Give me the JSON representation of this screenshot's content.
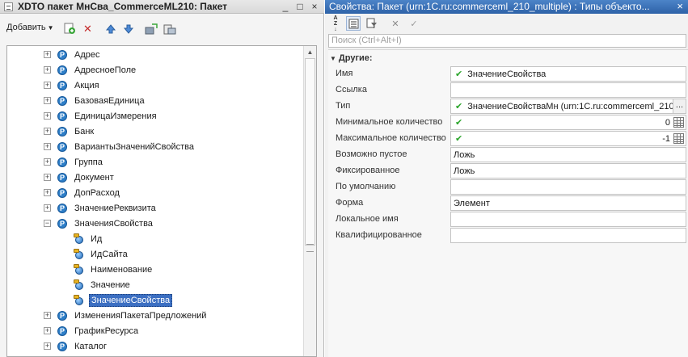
{
  "left_window": {
    "title": "XDTO пакет МнСва_CommerceML210: Пакет",
    "buttons": {
      "minimize": "_",
      "maximize": "□",
      "close": "×"
    },
    "toolbar": {
      "add_label": "Добавить",
      "icons": [
        "add-element-icon",
        "delete-icon",
        "move-up-icon",
        "move-down-icon",
        "import-icon",
        "export-icon"
      ]
    },
    "tree": {
      "items": [
        {
          "label": "Адрес",
          "kind": "package",
          "expanded": false
        },
        {
          "label": "АдресноеПоле",
          "kind": "package",
          "expanded": false
        },
        {
          "label": "Акция",
          "kind": "package",
          "expanded": false
        },
        {
          "label": "БазоваяЕдиница",
          "kind": "package",
          "expanded": false
        },
        {
          "label": "ЕдиницаИзмерения",
          "kind": "package",
          "expanded": false
        },
        {
          "label": "Банк",
          "kind": "package",
          "expanded": false
        },
        {
          "label": "ВариантыЗначенийСвойства",
          "kind": "package",
          "expanded": false
        },
        {
          "label": "Группа",
          "kind": "package",
          "expanded": false
        },
        {
          "label": "Документ",
          "kind": "package",
          "expanded": false
        },
        {
          "label": "ДопРасход",
          "kind": "package",
          "expanded": false
        },
        {
          "label": "ЗначениеРеквизита",
          "kind": "package",
          "expanded": false
        },
        {
          "label": "ЗначенияСвойства",
          "kind": "package",
          "expanded": true
        },
        {
          "label": "Ид",
          "kind": "property"
        },
        {
          "label": "ИдСайта",
          "kind": "property"
        },
        {
          "label": "Наименование",
          "kind": "property"
        },
        {
          "label": "Значение",
          "kind": "property"
        },
        {
          "label": "ЗначениеСвойства",
          "kind": "property",
          "selected": true
        },
        {
          "label": "ИзмененияПакетаПредложений",
          "kind": "package",
          "expanded": false
        },
        {
          "label": "ГрафикРесурса",
          "kind": "package",
          "expanded": false
        },
        {
          "label": "Каталог",
          "kind": "package",
          "expanded": false
        }
      ]
    }
  },
  "right_window": {
    "title": "Свойства: Пакет (urn:1C.ru:commerceml_210_multiple) : Типы объекто...",
    "close_button": "×",
    "toolbar_icons": [
      "sort-az-icon",
      "categorized-icon",
      "filter-icon",
      "clear-icon",
      "check-icon"
    ],
    "search": {
      "placeholder": "Поиск (Ctrl+Alt+I)"
    },
    "group": "Другие:",
    "properties": [
      {
        "label": "Имя",
        "value": "ЗначениеСвойства",
        "checked": true
      },
      {
        "label": "Ссылка",
        "value": ""
      },
      {
        "label": "Тип",
        "value": "ЗначениеСвойстваМн (urn:1C.ru:commerceml_210_",
        "checked": true,
        "has_button": true,
        "button_label": "..."
      },
      {
        "label": "Минимальное количество",
        "value": "0",
        "checked": true,
        "numeric": true
      },
      {
        "label": "Максимальное количество",
        "value": "-1",
        "checked": true,
        "numeric": true
      },
      {
        "label": "Возможно пустое",
        "value": "Ложь"
      },
      {
        "label": "Фиксированное",
        "value": "Ложь"
      },
      {
        "label": "По умолчанию",
        "value": ""
      },
      {
        "label": "Форма",
        "value": "Элемент"
      },
      {
        "label": "Локальное имя",
        "value": ""
      },
      {
        "label": "Квалифицированное",
        "value": ""
      }
    ]
  },
  "colors": {
    "right_title_bar": "#2e62a8",
    "selection": "#3c6fc2",
    "check_green": "#2aa52a"
  }
}
